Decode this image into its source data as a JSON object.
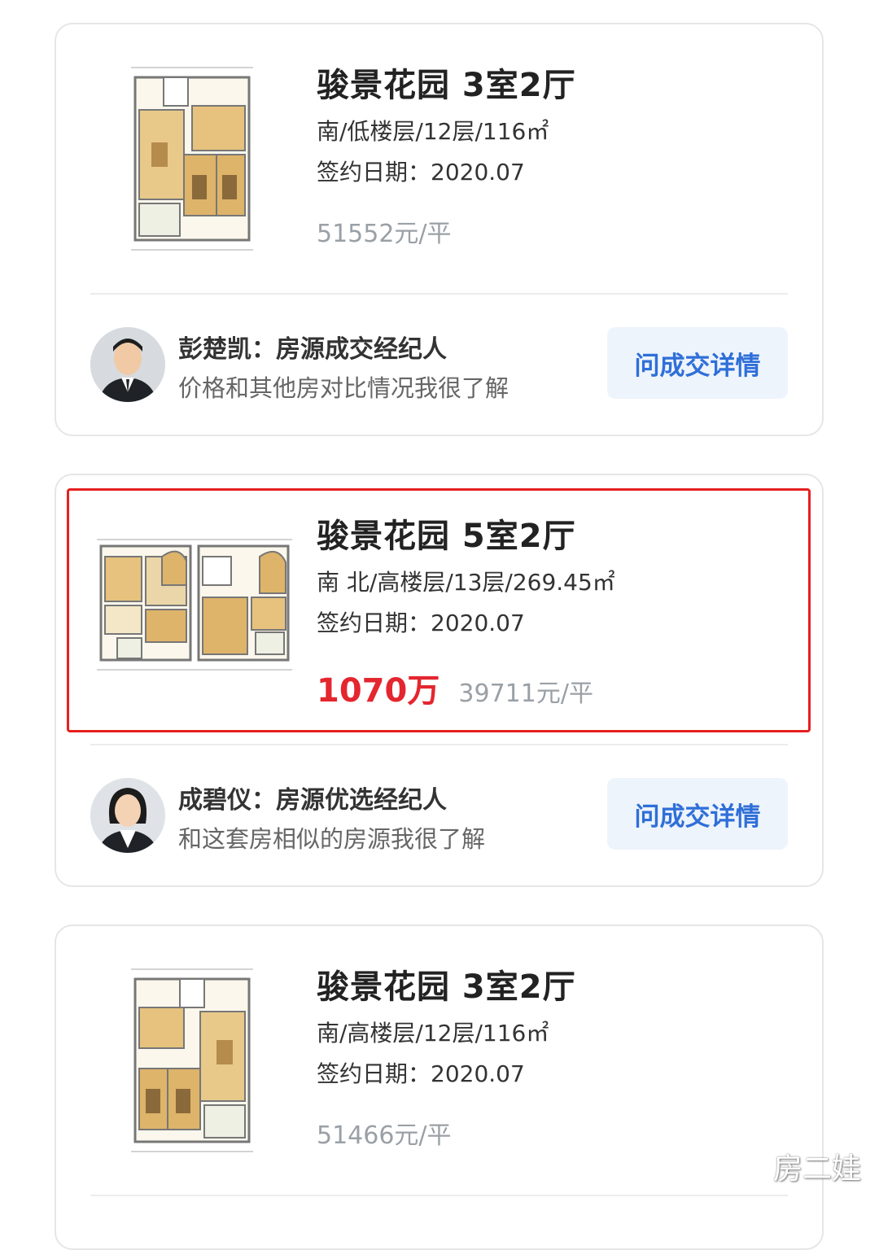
{
  "listings": [
    {
      "title": "骏景花园 3室2厅",
      "meta": "南/低楼层/12层/116㎡",
      "date": "签约日期：2020.07",
      "total_price": "",
      "unit_price": "51552元/平",
      "agent": {
        "name_line": "彭楚凯：房源成交经纪人",
        "desc": "价格和其他房对比情况我很了解",
        "button": "问成交详情"
      }
    },
    {
      "title": "骏景花园 5室2厅",
      "meta": "南 北/高楼层/13层/269.45㎡",
      "date": "签约日期：2020.07",
      "total_price": "1070万",
      "unit_price": "39711元/平",
      "agent": {
        "name_line": "成碧仪：房源优选经纪人",
        "desc": "和这套房相似的房源我很了解",
        "button": "问成交详情"
      }
    },
    {
      "title": "骏景花园 3室2厅",
      "meta": "南/高楼层/12层/116㎡",
      "date": "签约日期：2020.07",
      "total_price": "",
      "unit_price": "51466元/平"
    }
  ],
  "watermark": "房二娃",
  "colors": {
    "price_red": "#e4262f",
    "button_blue": "#2f6fd8",
    "button_bg": "#eef4fc",
    "highlight_red": "#e5201f"
  }
}
